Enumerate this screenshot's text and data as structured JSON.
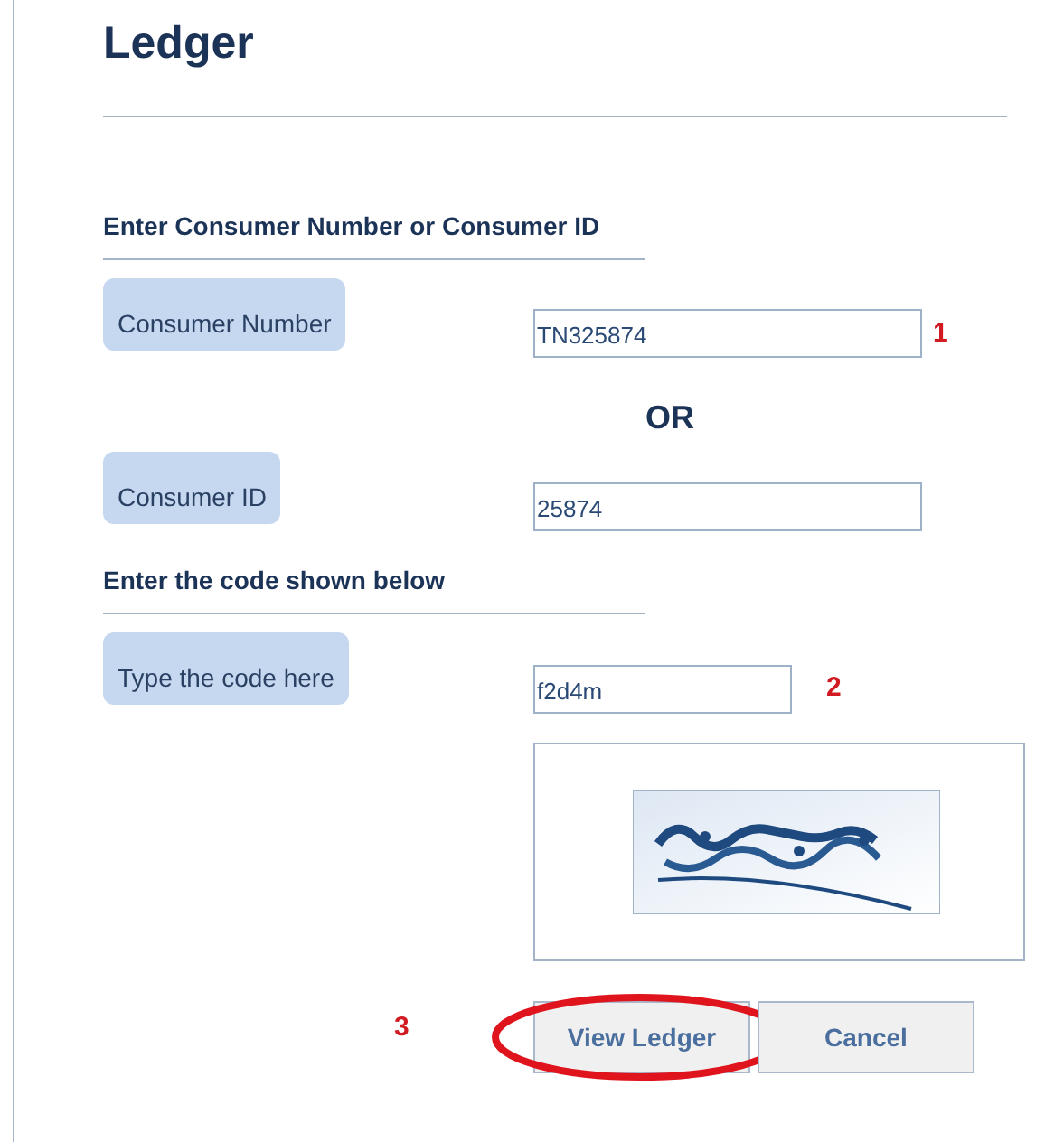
{
  "title": "Ledger",
  "sections": [
    {
      "heading": "Enter Consumer Number or Consumer ID",
      "rows": [
        {
          "kind": "field",
          "label": "Consumer Number",
          "value": "TN325874",
          "marker": "1"
        },
        {
          "kind": "separator",
          "text": "OR"
        },
        {
          "kind": "field",
          "label": "Consumer ID",
          "value": "25874"
        }
      ]
    },
    {
      "heading": "Enter the code shown below",
      "rows": [
        {
          "kind": "code",
          "label": "Type the code here",
          "value": "f2d4m",
          "marker": "2"
        },
        {
          "kind": "captcha"
        }
      ]
    }
  ],
  "actions": {
    "marker": "3",
    "buttons": [
      {
        "label": "View Ledger",
        "highlighted": true
      },
      {
        "label": "Cancel",
        "highlighted": false
      }
    ]
  }
}
